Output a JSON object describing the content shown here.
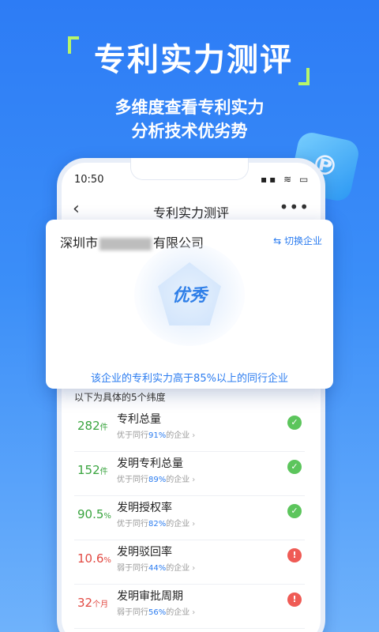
{
  "hero": {
    "title": "专利实力测评",
    "sub1": "多维度查看专利实力",
    "sub2": "分析技术优劣势"
  },
  "status": {
    "time": "10:50",
    "icons": "▪▪ ≋ ▭"
  },
  "nav": {
    "title": "专利实力测评"
  },
  "company": {
    "name_prefix": "深圳市",
    "name_suffix": "有限公司",
    "switch_label": "切换企业",
    "badge": "优秀",
    "summary": "该企业的专利实力高于85%以上的同行企业"
  },
  "dims_title": "以下为具体的5个纬度",
  "rows": [
    {
      "value": "282",
      "unit": "件",
      "name": "专利总量",
      "pre": "优于同行",
      "pct": "91%",
      "post": "的企业",
      "status": "ok"
    },
    {
      "value": "152",
      "unit": "件",
      "name": "发明专利总量",
      "pre": "优于同行",
      "pct": "89%",
      "post": "的企业",
      "status": "ok"
    },
    {
      "value": "90.5",
      "unit": "%",
      "name": "发明授权率",
      "pre": "优于同行",
      "pct": "82%",
      "post": "的企业",
      "status": "ok"
    },
    {
      "value": "10.6",
      "unit": "%",
      "name": "发明驳回率",
      "pre": "弱于同行",
      "pct": "44%",
      "post": "的企业",
      "status": "bad"
    },
    {
      "value": "32",
      "unit": "个月",
      "name": "发明审批周期",
      "pre": "弱于同行",
      "pct": "56%",
      "post": "的企业",
      "status": "bad"
    }
  ],
  "colors": {
    "accent": "#2b7cf0",
    "good": "#39a43f",
    "bad": "#e24a43"
  }
}
